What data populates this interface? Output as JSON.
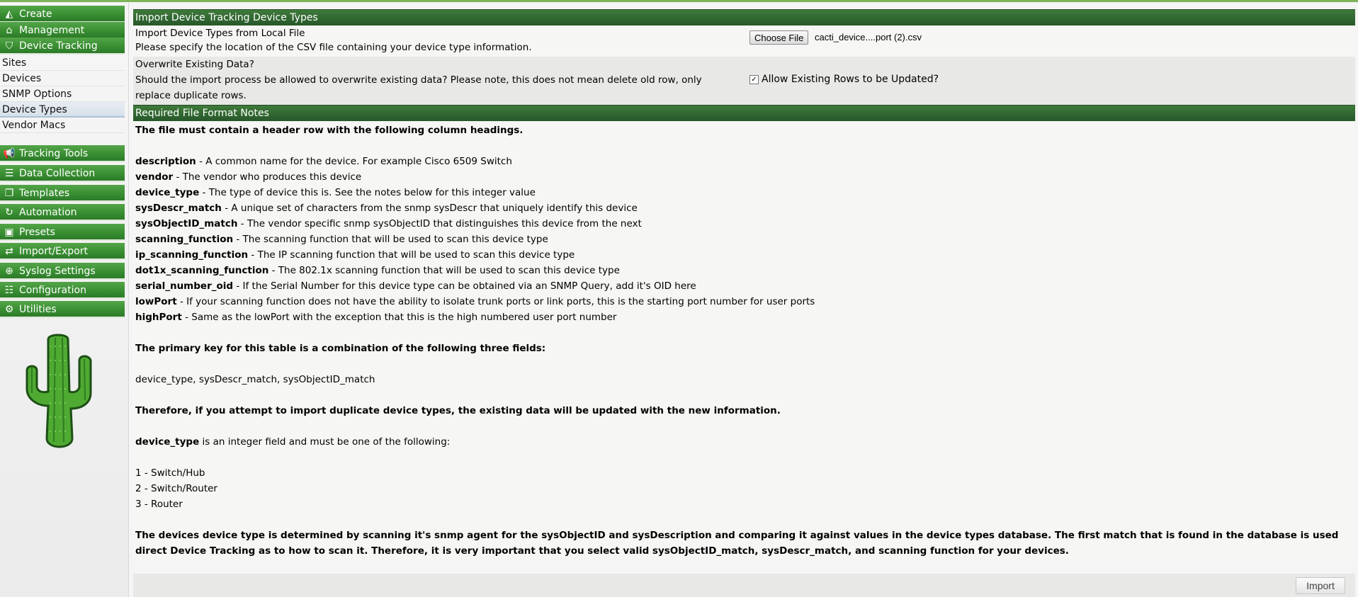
{
  "sidebar": {
    "create": "Create",
    "management": "Management",
    "device_tracking": "Device Tracking",
    "sub_items": [
      "Sites",
      "Devices",
      "SNMP Options",
      "Device Types",
      "Vendor Macs"
    ],
    "tracking_tools": "Tracking Tools",
    "data_collection": "Data Collection",
    "templates": "Templates",
    "automation": "Automation",
    "presets": "Presets",
    "import_export": "Import/Export",
    "syslog_settings": "Syslog Settings",
    "configuration": "Configuration",
    "utilities": "Utilities"
  },
  "header": {
    "title": "Import Device Tracking Device Types"
  },
  "file_row": {
    "label": "Import Device Types from Local File",
    "description": "Please specify the location of the CSV file containing your device type information.",
    "choose_button": "Choose File",
    "file_name": "cacti_device....port (2).csv"
  },
  "overwrite_row": {
    "label": "Overwrite Existing Data?",
    "description": "Should the import process be allowed to overwrite existing data? Please note, this does not mean delete old row, only replace duplicate rows.",
    "checkbox_label": "Allow Existing Rows to be Updated?",
    "checked": true
  },
  "notes": {
    "title": "Required File Format Notes",
    "header_row_note": "The file must contain a header row with the following column headings.",
    "fields": [
      {
        "name": "description",
        "desc": " - A common name for the device. For example Cisco 6509 Switch"
      },
      {
        "name": "vendor",
        "desc": " - The vendor who produces this device"
      },
      {
        "name": "device_type",
        "desc": " - The type of device this is. See the notes below for this integer value"
      },
      {
        "name": "sysDescr_match",
        "desc": " - A unique set of characters from the snmp sysDescr that uniquely identify this device"
      },
      {
        "name": "sysObjectID_match",
        "desc": " - The vendor specific snmp sysObjectID that distinguishes this device from the next"
      },
      {
        "name": "scanning_function",
        "desc": " - The scanning function that will be used to scan this device type"
      },
      {
        "name": "ip_scanning_function",
        "desc": " - The IP scanning function that will be used to scan this device type"
      },
      {
        "name": "dot1x_scanning_function",
        "desc": " - The 802.1x scanning function that will be used to scan this device type"
      },
      {
        "name": "serial_number_oid",
        "desc": " - If the Serial Number for this device type can be obtained via an SNMP Query, add it's OID here"
      },
      {
        "name": "lowPort",
        "desc": " - If your scanning function does not have the ability to isolate trunk ports or link ports, this is the starting port number for user ports"
      },
      {
        "name": "highPort",
        "desc": " - Same as the lowPort with the exception that this is the high numbered user port number"
      }
    ],
    "primary_key_note": "The primary key for this table is a combination of the following three fields:",
    "primary_key_fields": "device_type, sysDescr_match, sysObjectID_match",
    "duplicate_note": "Therefore, if you attempt to import duplicate device types, the existing data will be updated with the new information.",
    "device_type_name": "device_type",
    "device_type_note": " is an integer field and must be one of the following:",
    "device_type_values": [
      "1 - Switch/Hub",
      "2 - Switch/Router",
      "3 - Router"
    ],
    "closing_note": "The devices device type is determined by scanning it's snmp agent for the sysObjectID and sysDescription and comparing it against values in the device types database. The first match that is found in the database is used direct Device Tracking as to how to scan it. Therefore, it is very important that you select valid sysObjectID_match, sysDescr_match, and scanning function for your devices."
  },
  "footer": {
    "import_button": "Import"
  },
  "colors": {
    "accent_green": "#3a8f33",
    "header_green": "#2f6530"
  }
}
